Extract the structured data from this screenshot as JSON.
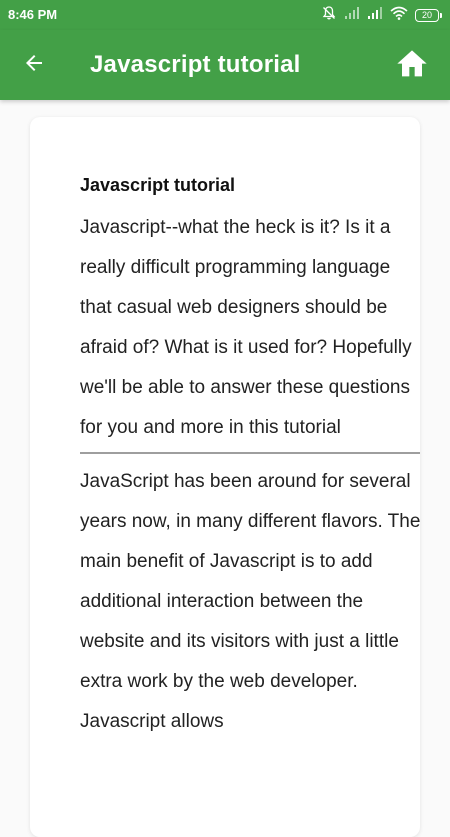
{
  "status_bar": {
    "time": "8:46 PM",
    "battery": "20",
    "icons": [
      "mute-icon",
      "signal-icon",
      "signal-icon",
      "wifi-icon",
      "battery-icon"
    ]
  },
  "app_bar": {
    "title": "Javascript tutorial",
    "back_icon": "arrow-left-icon",
    "home_icon": "home-icon",
    "color": "#43a047"
  },
  "content": {
    "title": "Javascript tutorial",
    "paragraph1": "Javascript--what the heck is it? Is it a really difficult programming language that casual web designers should be afraid of? What is it used for? Hopefully we'll be able to answer these questions for you and more in this tutorial",
    "paragraph2": "JavaScript has been around for several years now, in many different flavors. The main benefit of Javascript is to add additional interaction between the website and its visitors with just a little extra work by the web developer. Javascript allows"
  }
}
